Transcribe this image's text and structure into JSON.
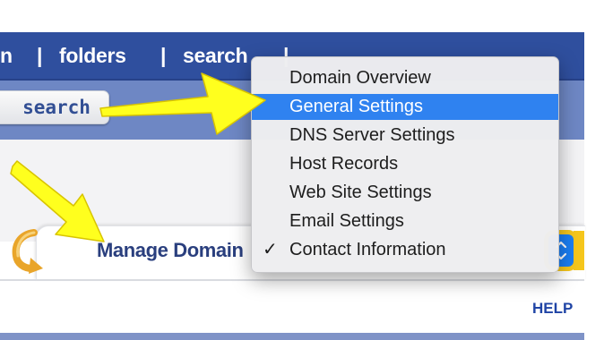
{
  "topnav": {
    "items": [
      "n",
      "|",
      "folders",
      "|",
      "search",
      "|"
    ]
  },
  "subbar": {
    "search_button_label": "search"
  },
  "panel": {
    "manage_label": "Manage Domain",
    "help_link": "HELP"
  },
  "dropdown": {
    "items": [
      {
        "label": "Domain Overview"
      },
      {
        "label": "General Settings"
      },
      {
        "label": "DNS Server Settings"
      },
      {
        "label": "Host Records"
      },
      {
        "label": "Web Site Settings"
      },
      {
        "label": "Email Settings"
      },
      {
        "label": "Contact Information"
      }
    ],
    "highlighted_item": "General Settings",
    "checked_item": "Contact Information",
    "check_glyph": "✓"
  },
  "colors": {
    "nav_blue": "#2f4f9e",
    "subbar_blue": "#6e87c4",
    "highlight": "#2f82f0",
    "annotation_arrow": "#ffff1e",
    "select_border": "#f5c61c"
  },
  "icons": [
    "back-arrow-icon",
    "select-stepper-icon",
    "checkmark-icon",
    "annotation-arrow"
  ]
}
